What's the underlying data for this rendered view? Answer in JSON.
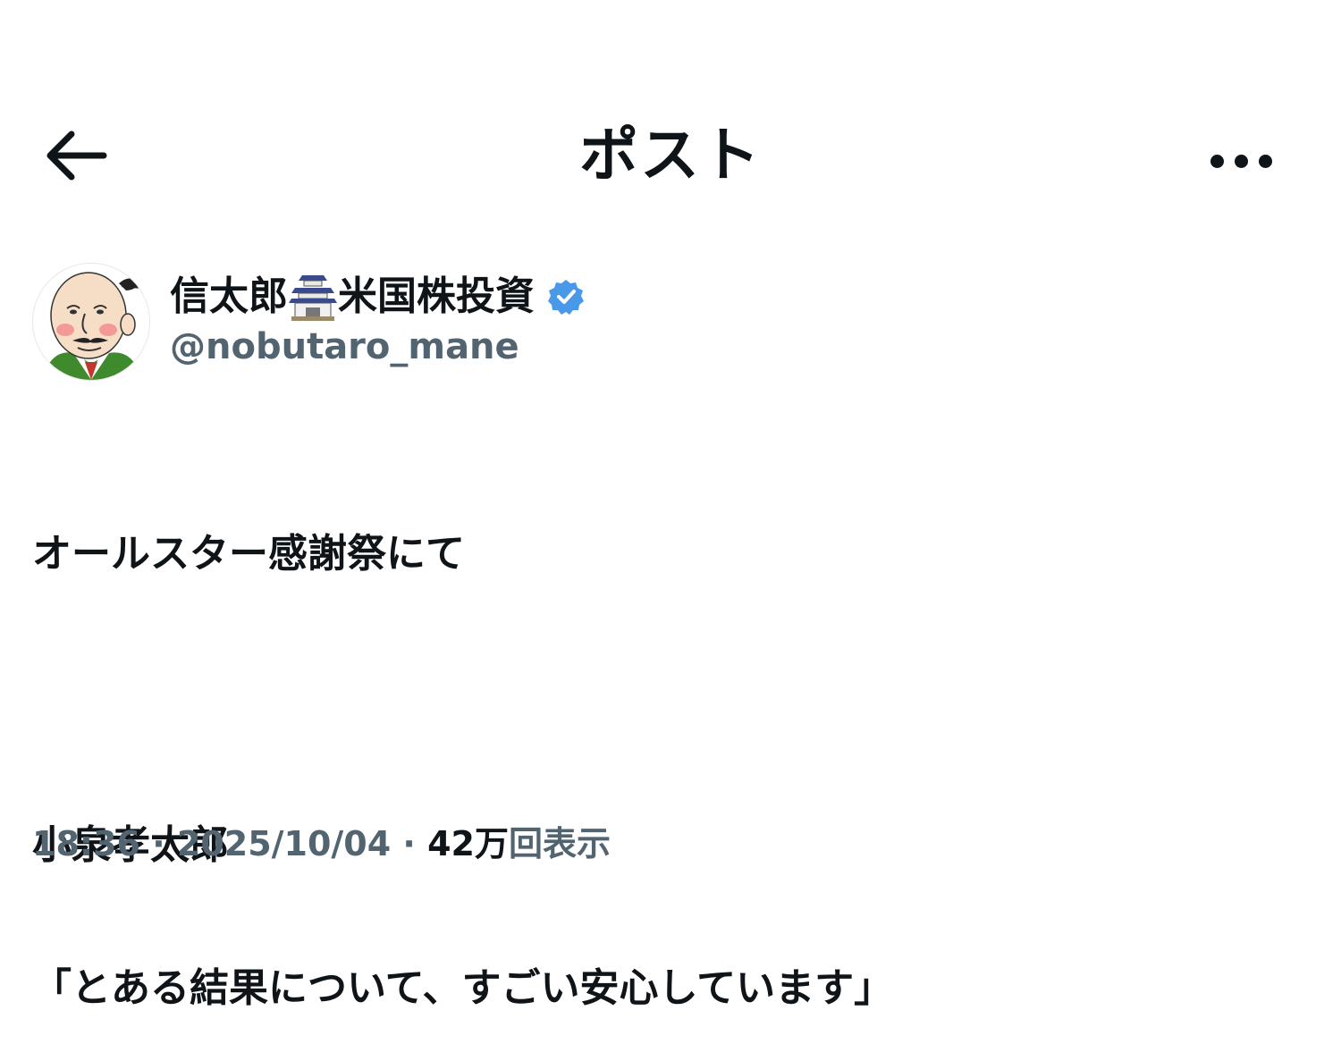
{
  "header": {
    "title": "ポスト",
    "back_icon": "arrow-left-icon",
    "more_icon": "more-horizontal-icon"
  },
  "author": {
    "name_part1": "信太郎",
    "name_emoji": "castle-icon",
    "name_part2": "米国株投資",
    "verified_icon": "verified-badge-icon",
    "handle": "@nobutaro_mane",
    "verified_color": "#4a99e9"
  },
  "post": {
    "lines": [
      "オールスター感謝祭にて",
      "",
      "小泉孝太郎",
      "「とある結果について、すごい安心しています」"
    ]
  },
  "meta": {
    "time": "18:36",
    "separator": " · ",
    "date": "2025/10/04",
    "views_count": "42万",
    "views_label": "回表示"
  }
}
